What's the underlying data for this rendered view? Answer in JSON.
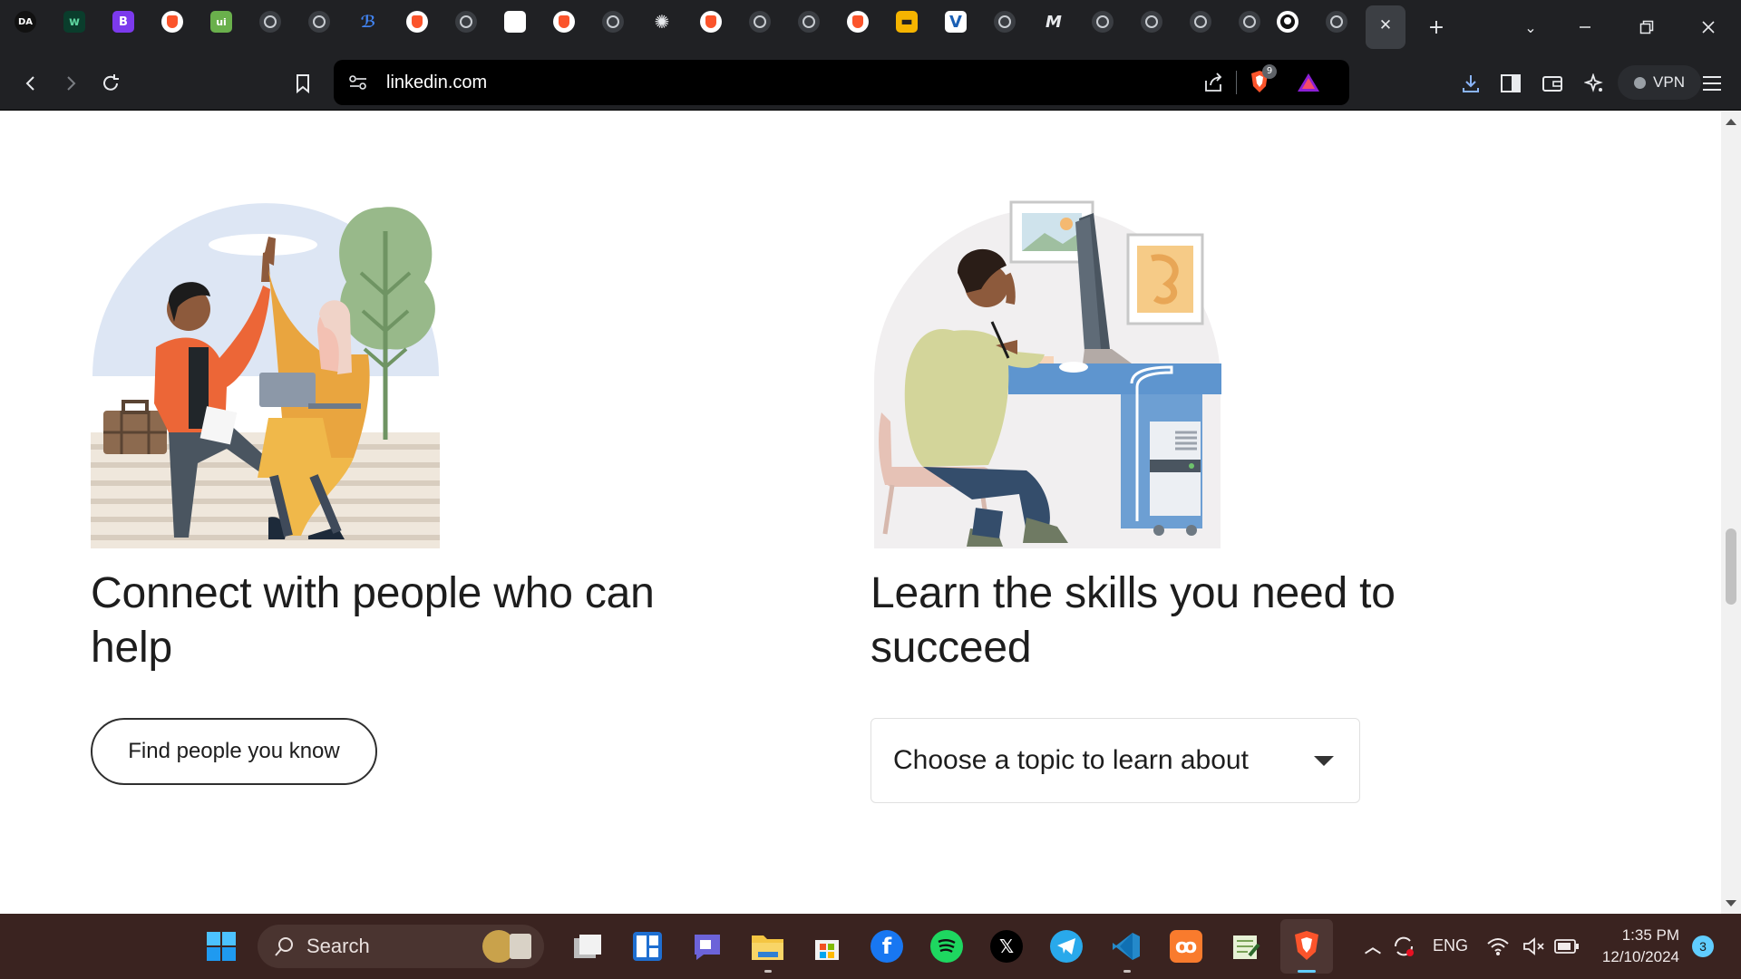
{
  "browser": {
    "url": "linkedin.com",
    "vpn_label": "VPN",
    "shields_badge": "9",
    "first_tab_label": "DA",
    "b_tab_label": "B",
    "m_tab_label": "M",
    "new_tab_symbol": "+",
    "close_tab_symbol": "✕"
  },
  "page": {
    "connect_heading": "Connect with people who can help",
    "learn_heading": "Learn the skills you need to succeed",
    "find_people_button": "Find people you know",
    "topic_select_placeholder": "Choose a topic to learn about"
  },
  "taskbar": {
    "search_label": "Search",
    "language": "ENG",
    "time": "1:35 PM",
    "date": "12/10/2024",
    "notification_count": "3"
  }
}
